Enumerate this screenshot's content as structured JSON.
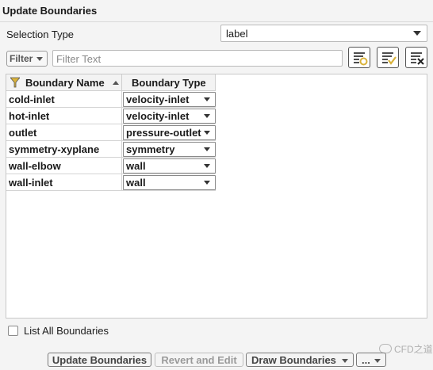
{
  "window": {
    "title": "Update Boundaries"
  },
  "selection": {
    "label": "Selection Type",
    "value": "label"
  },
  "filter": {
    "button_label": "Filter",
    "placeholder": "Filter Text"
  },
  "toolbar": {
    "icons": [
      "select-matching-icon",
      "check-all-icon",
      "clear-selection-icon"
    ]
  },
  "table": {
    "columns": [
      "Boundary Name",
      "Boundary Type"
    ],
    "rows": [
      {
        "name": "cold-inlet",
        "type": "velocity-inlet"
      },
      {
        "name": "hot-inlet",
        "type": "velocity-inlet"
      },
      {
        "name": "outlet",
        "type": "pressure-outlet"
      },
      {
        "name": "symmetry-xyplane",
        "type": "symmetry"
      },
      {
        "name": "wall-elbow",
        "type": "wall"
      },
      {
        "name": "wall-inlet",
        "type": "wall"
      }
    ]
  },
  "options": {
    "list_all_label": "List All Boundaries",
    "list_all_checked": false
  },
  "actions": {
    "update": "Update Boundaries",
    "revert": "Revert and Edit",
    "draw": "Draw Boundaries",
    "more": "..."
  },
  "watermark": {
    "text": "CFD之道"
  },
  "colors": {
    "accent": "#d9b23a",
    "border": "#7a7a7a"
  }
}
